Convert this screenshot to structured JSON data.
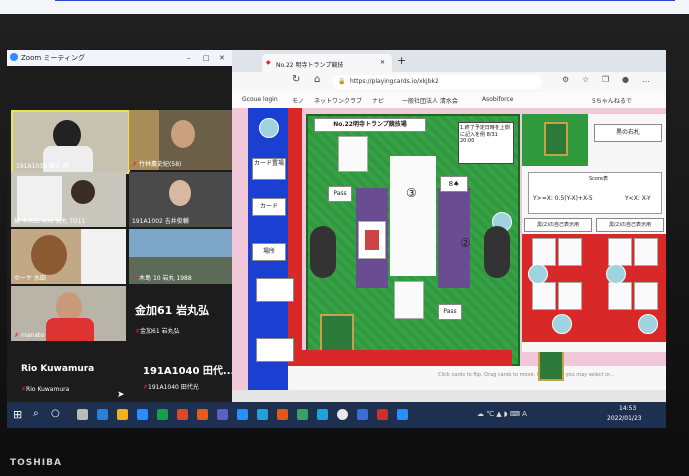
{
  "browser": {
    "tab_title": "No.22 明寺トランプ競技",
    "url": "https://playingcards.io/xkjbk2",
    "bookmarks": [
      "Gcoue login",
      "モノ",
      "ネットワンクラブ",
      "ナビ",
      "一般社団法人 清水会",
      "Asobiforce",
      "5ちゃんねるで"
    ]
  },
  "zoom": {
    "title": "Zoom ミーティング",
    "participants": [
      {
        "name": "191A1036 高丸 翔"
      },
      {
        "name": "竹林農史紀(58)"
      },
      {
        "name": "鍋 木木田 A36 高丸 TO11"
      },
      {
        "name": "191A1002 吉井俊輔"
      },
      {
        "name": "ホーヤ 水田"
      },
      {
        "name": "木島 10 岩丸 1988"
      },
      {
        "name": "manato"
      }
    ],
    "big_labels": {
      "kin": "金加61 岩丸弘",
      "kin_sub": "金加61 岩丸弘",
      "rio": "Rio Kuwamura",
      "rio_sub": "Rio Kuwamura",
      "g191": "191A1040 田代...",
      "g191_sub": "191A1040 田代光"
    }
  },
  "game": {
    "board_title": "No.22明寺トランプ競技場",
    "deadline_note": "1.終了予定日時を上側に記入を例 8/31 20:00",
    "pass_top": "Pass",
    "pass_bottom": "Pass",
    "seat_3": "③",
    "seat_2": "②",
    "small_card": "8♠",
    "score_title": "Score表",
    "formula_1": "Y>=X: 0.5(Y-X)+X-5",
    "formula_2": "Y<X: X-Y",
    "panel_left": "黒(2)の自己表示用",
    "panel_right": "黒(2)の自己表示用",
    "top_label": "黒の右札",
    "side_labels": [
      "カード置場",
      "カード",
      "場所"
    ],
    "hint": "Click cards to flip. Drag cards to move. Click cards you may select or..."
  },
  "taskbar": {
    "time": "14:53",
    "date": "2022/01/23"
  },
  "laptop_brand": "TOSHIBA",
  "colors": {
    "felt": "#2e9a3d",
    "blue_rail": "#1b3fd0",
    "pink": "#f0c8da"
  }
}
